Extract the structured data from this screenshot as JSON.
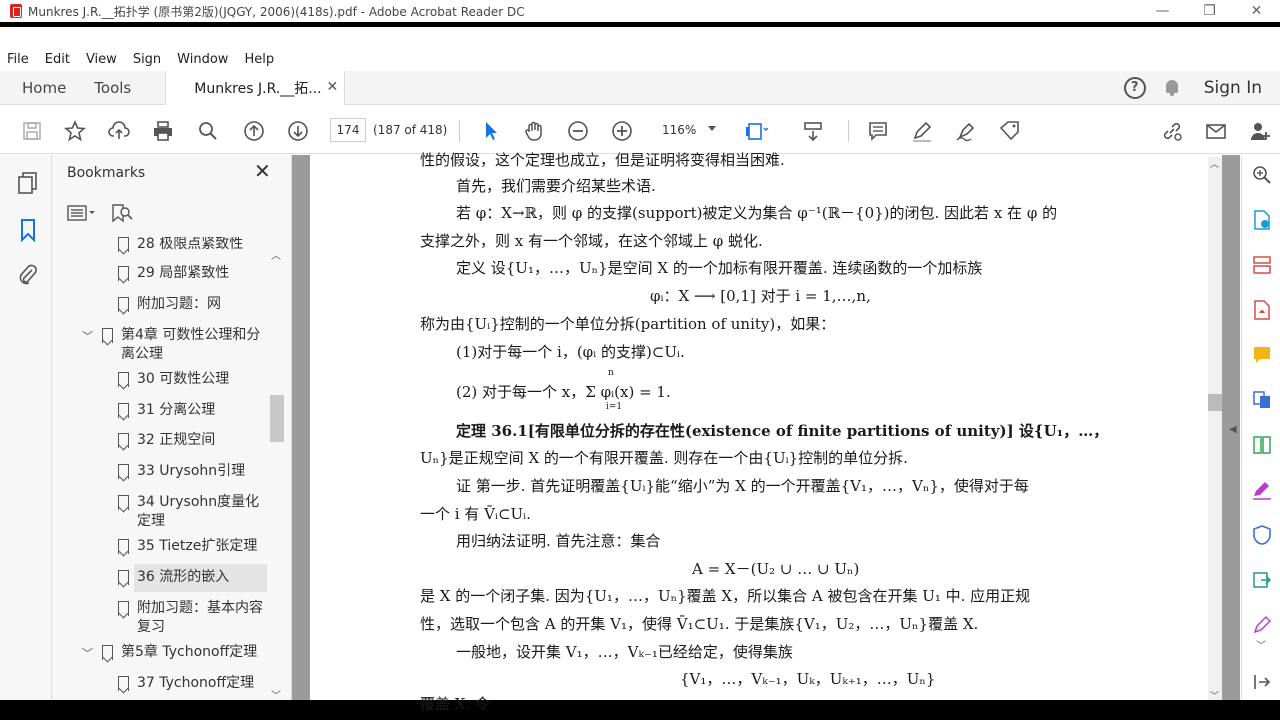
{
  "window": {
    "title": "Munkres J.R.__拓扑学 (原书第2版)(JQGY, 2006)(418s).pdf - Adobe Acrobat Reader DC",
    "minimize": "—",
    "restore": "❐",
    "close": "✕"
  },
  "menu": [
    "File",
    "Edit",
    "View",
    "Sign",
    "Window",
    "Help"
  ],
  "tabs": {
    "home": "Home",
    "tools": "Tools",
    "document": "Munkres J.R.__拓...",
    "help": "?",
    "signin": "Sign In"
  },
  "toolbar": {
    "page_number": "174",
    "page_count": "(187 of 418)",
    "zoom": "116%"
  },
  "bookmarks": {
    "title": "Bookmarks",
    "items": [
      {
        "label": "28 极限点紧致性"
      },
      {
        "label": "29 局部紧致性"
      },
      {
        "label": "附加习题：网"
      },
      {
        "label": "第4章 可数性公理和分离公理"
      },
      {
        "label": "30 可数性公理"
      },
      {
        "label": "31 分离公理"
      },
      {
        "label": "32 正规空间"
      },
      {
        "label": "33 Urysohn引理"
      },
      {
        "label": "34 Urysohn度量化定理"
      },
      {
        "label": "35 Tietze扩张定理"
      },
      {
        "label": "36 流形的嵌入"
      },
      {
        "label": "附加习题：基本内容复习"
      },
      {
        "label": "第5章 Tychonoff定理"
      },
      {
        "label": "37 Tychonoff定理"
      }
    ]
  },
  "document": {
    "lines": [
      "性的假设，这个定理也成立，但是证明将变得相当困难.",
      "首先，我们需要介绍某些术语.",
      "若 φ：X→ℝ，则 φ 的支撑(support)被定义为集合 φ⁻¹(ℝ－{0})的闭包. 因此若 x 在 φ 的",
      "支撑之外，则 x 有一个邻域，在这个邻域上 φ 蜕化.",
      "定义   设{U₁，…，Uₙ}是空间 X 的一个加标有限开覆盖. 连续函数的一个加标族",
      "φᵢ：X ⟶ [0,1]    对于 i = 1,…,n,",
      "称为由{Uᵢ}控制的一个单位分拆(partition of unity)，如果：",
      "(1)对于每一个 i，(φᵢ 的支撑)⊂Uᵢ.",
      "(2) 对于每一个 x，Σ φᵢ(x) = 1.",
      "定理 36.1[有限单位分拆的存在性(existence of finite partitions of unity)]  设{U₁，…，",
      "Uₙ}是正规空间 X 的一个有限开覆盖. 则存在一个由{Uᵢ}控制的单位分拆.",
      "证   第一步. 首先证明覆盖{Uᵢ}能“缩小”为 X 的一个开覆盖{V₁，…，Vₙ}，使得对于每",
      "一个 i 有 V̄ᵢ⊂Uᵢ.",
      "用归纳法证明. 首先注意：集合",
      "A = X－(U₂ ∪ … ∪ Uₙ)",
      "是 X 的一个闭子集. 因为{U₁，…，Uₙ}覆盖 X，所以集合 A 被包含在开集 U₁ 中. 应用正规",
      "性，选取一个包含 A 的开集 V₁，使得 V̄₁⊂U₁. 于是集族{V₁，U₂，…，Uₙ}覆盖 X.",
      "一般地，设开集 V₁，…，Vₖ₋₁已经给定，使得集族",
      "{V₁，…，Vₖ₋₁，Uₖ，Uₖ₊₁，…，Uₙ}",
      "覆盖 X. 令"
    ],
    "sum_top": "n",
    "sum_bottom": "i=1"
  },
  "colors": {
    "accent": "#1473e6",
    "signature_tool": "#3b6fd8"
  }
}
